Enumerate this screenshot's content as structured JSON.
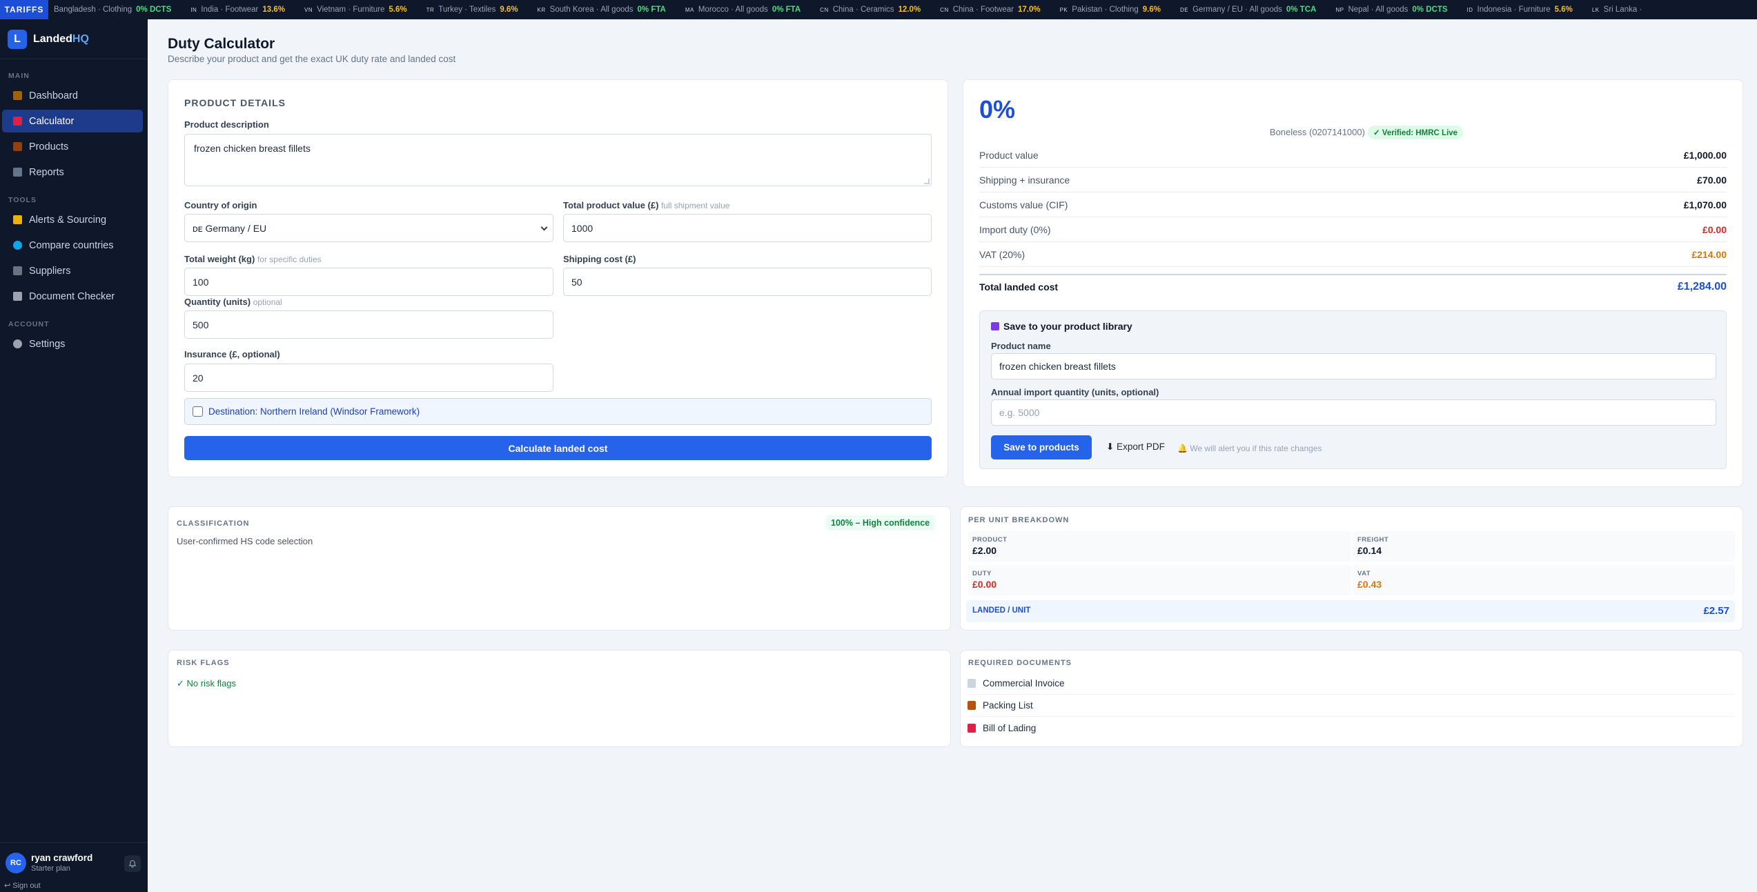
{
  "ticker": {
    "label": "TARIFFS",
    "items": [
      {
        "flag": "",
        "name": "Bangladesh · Clothing",
        "rate": "0% DCTS",
        "zero": true
      },
      {
        "flag": "IN",
        "name": "India · Footwear",
        "rate": "13.6%",
        "zero": false
      },
      {
        "flag": "VN",
        "name": "Vietnam · Furniture",
        "rate": "5.6%",
        "zero": false
      },
      {
        "flag": "TR",
        "name": "Turkey · Textiles",
        "rate": "9.6%",
        "zero": false
      },
      {
        "flag": "KR",
        "name": "South Korea · All goods",
        "rate": "0% FTA",
        "zero": true
      },
      {
        "flag": "MA",
        "name": "Morocco · All goods",
        "rate": "0% FTA",
        "zero": true
      },
      {
        "flag": "CN",
        "name": "China · Ceramics",
        "rate": "12.0%",
        "zero": false
      },
      {
        "flag": "CN",
        "name": "China · Footwear",
        "rate": "17.0%",
        "zero": false
      },
      {
        "flag": "PK",
        "name": "Pakistan · Clothing",
        "rate": "9.6%",
        "zero": false
      },
      {
        "flag": "DE",
        "name": "Germany / EU · All goods",
        "rate": "0% TCA",
        "zero": true
      },
      {
        "flag": "NP",
        "name": "Nepal · All goods",
        "rate": "0% DCTS",
        "zero": true
      },
      {
        "flag": "ID",
        "name": "Indonesia · Furniture",
        "rate": "5.6%",
        "zero": false
      },
      {
        "flag": "LK",
        "name": "Sri Lanka ·",
        "rate": "",
        "zero": false
      }
    ]
  },
  "brand": {
    "mark": "L",
    "name": "Landed",
    "suffix": "HQ"
  },
  "sidebar": {
    "main_label": "MAIN",
    "main": [
      {
        "label": "Dashboard",
        "icon": "dashboard-icon"
      },
      {
        "label": "Calculator",
        "icon": "calculator-icon"
      },
      {
        "label": "Products",
        "icon": "box-icon"
      },
      {
        "label": "Reports",
        "icon": "chart-icon"
      }
    ],
    "tools_label": "TOOLS",
    "tools": [
      {
        "label": "Alerts & Sourcing",
        "icon": "bell-icon"
      },
      {
        "label": "Compare countries",
        "icon": "globe-icon"
      },
      {
        "label": "Suppliers",
        "icon": "building-icon"
      },
      {
        "label": "Document Checker",
        "icon": "document-icon"
      }
    ],
    "account_label": "ACCOUNT",
    "account": [
      {
        "label": "Settings",
        "icon": "gear-icon"
      }
    ]
  },
  "user": {
    "initials": "RC",
    "name": "ryan crawford",
    "plan": "Starter plan",
    "signout": "↩ Sign out"
  },
  "page": {
    "title": "Duty Calculator",
    "subtitle": "Describe your product and get the exact UK duty rate and landed cost"
  },
  "form": {
    "section": "PRODUCT DETAILS",
    "desc_label": "Product description",
    "desc_value": "frozen chicken breast fillets",
    "country_label": "Country of origin",
    "country_value": "ᴅᴇ Germany / EU",
    "value_label": "Total product value (£)",
    "value_hint": "full shipment value",
    "value_value": "1000",
    "weight_label": "Total weight (kg)",
    "weight_hint": "for specific duties",
    "weight_value": "100",
    "shipping_label": "Shipping cost (£)",
    "shipping_value": "50",
    "qty_label": "Quantity (units)",
    "qty_hint": "optional",
    "qty_value": "500",
    "insurance_label": "Insurance (£, optional)",
    "insurance_value": "20",
    "ni_label": "Destination: Northern Ireland (Windsor Framework)",
    "calc_button": "Calculate landed cost"
  },
  "result": {
    "rate": "0%",
    "hs": "Boneless (0207141000)",
    "verified": "✓ Verified: HMRC Live",
    "rows": [
      {
        "label": "Product value",
        "value": "£1,000.00"
      },
      {
        "label": "Shipping + insurance",
        "value": "£70.00"
      },
      {
        "label": "Customs value (CIF)",
        "value": "£1,070.00"
      },
      {
        "label": "Import duty (0%)",
        "value": "£0.00"
      },
      {
        "label": "VAT (20%)",
        "value": "£214.00"
      }
    ],
    "total_label": "Total landed cost",
    "total_value": "£1,284.00",
    "save_title": "Save to your product library",
    "name_label": "Product name",
    "name_value": "frozen chicken breast fillets",
    "annual_label": "Annual import quantity (units, optional)",
    "annual_placeholder": "e.g. 5000",
    "save_button": "Save to products",
    "export_button": "⬇ Export PDF",
    "alert_note": "We will alert you if this rate changes"
  },
  "classification": {
    "heading": "CLASSIFICATION",
    "confidence": "100% – High confidence",
    "text": "User-confirmed HS code selection"
  },
  "per_unit": {
    "heading": "PER UNIT BREAKDOWN",
    "product_label": "PRODUCT",
    "product_value": "£2.00",
    "freight_label": "FREIGHT",
    "freight_value": "£0.14",
    "duty_label": "DUTY",
    "duty_value": "£0.00",
    "vat_label": "VAT",
    "vat_value": "£0.43",
    "landed_label": "LANDED / UNIT",
    "landed_value": "£2.57"
  },
  "risk": {
    "heading": "RISK FLAGS",
    "text": "✓ No risk flags"
  },
  "documents": {
    "heading": "REQUIRED DOCUMENTS",
    "items": [
      {
        "label": "Commercial Invoice",
        "icon": "invoice-icon",
        "color": "#cbd5e1"
      },
      {
        "label": "Packing List",
        "icon": "package-icon",
        "color": "#b45309"
      },
      {
        "label": "Bill of Lading",
        "icon": "ship-icon",
        "color": "#e11d48"
      }
    ]
  },
  "colors": {
    "accent": "#2563eb",
    "sidebar": "#0f172a",
    "danger": "#dc2626",
    "warning": "#d97706",
    "success": "#15803d"
  }
}
